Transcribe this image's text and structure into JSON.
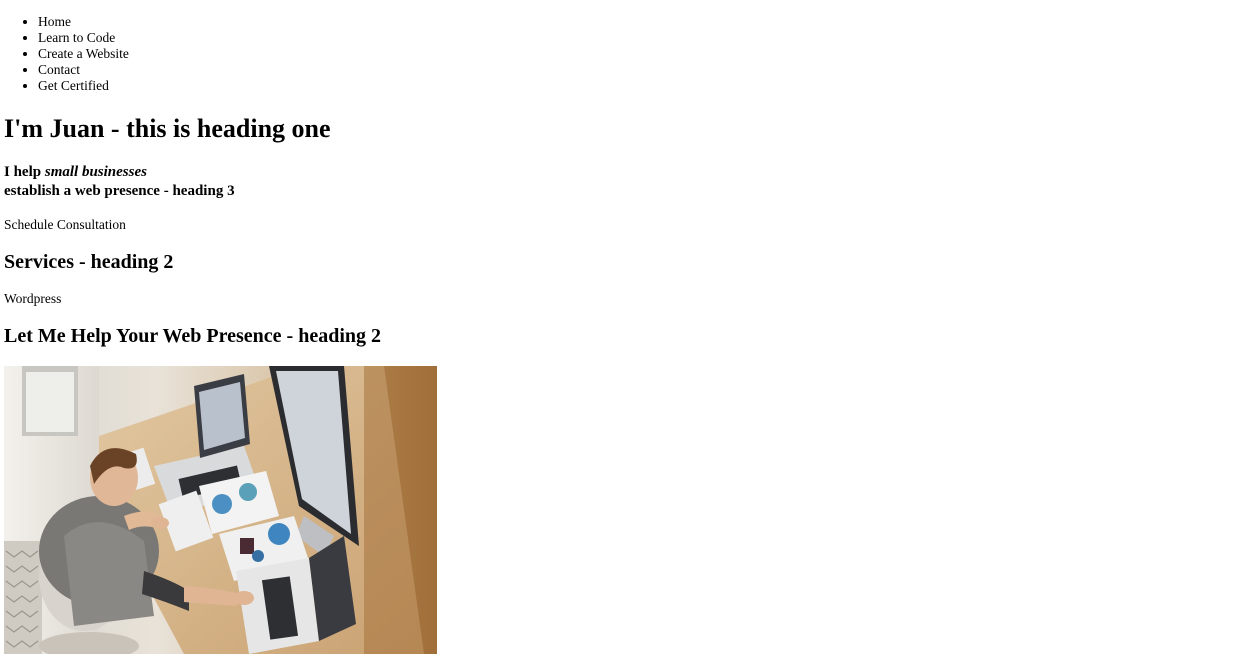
{
  "nav": {
    "items": [
      {
        "label": "Home"
      },
      {
        "label": "Learn to Code"
      },
      {
        "label": "Create a Website"
      },
      {
        "label": "Contact"
      },
      {
        "label": "Get Certified"
      }
    ]
  },
  "hero": {
    "heading": "I'm Juan - this is heading one",
    "sub_prefix": "I help ",
    "sub_emphasis": "small businesses",
    "sub_line2": "establish a web presence - heading 3",
    "cta": "Schedule Consultation"
  },
  "services": {
    "heading": "Services - heading 2",
    "items": [
      "Wordpress"
    ]
  },
  "help": {
    "heading": "Let Me Help Your Web Presence - heading 2",
    "image_icon": "man-at-desk-with-laptops-photo"
  }
}
